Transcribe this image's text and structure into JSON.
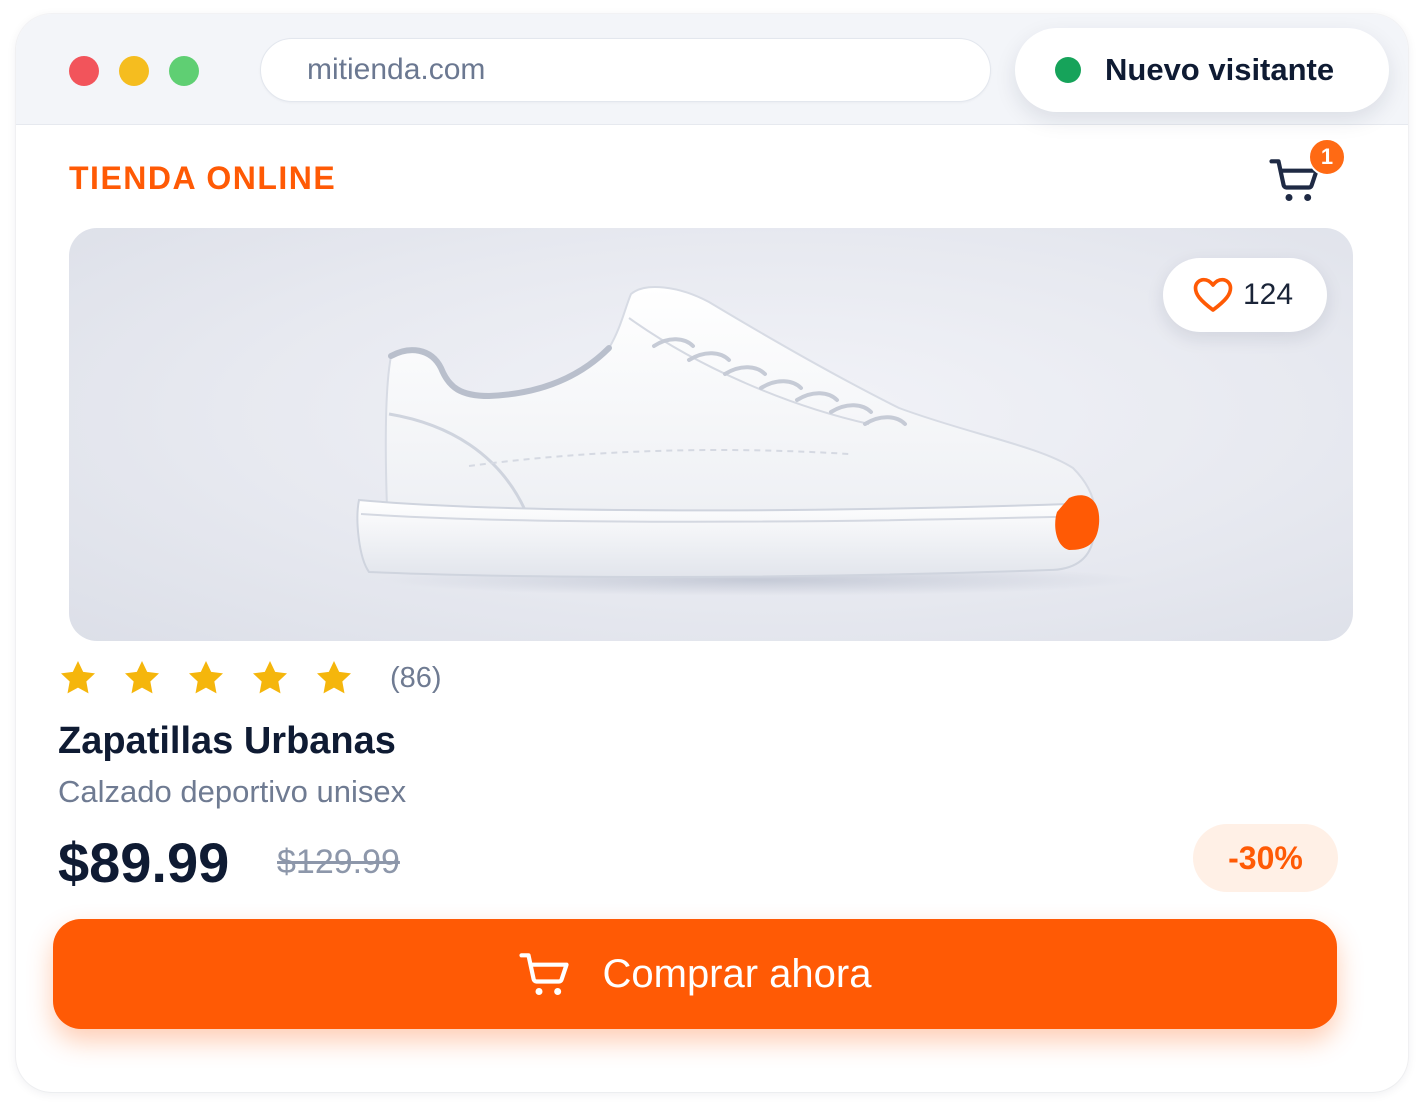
{
  "browser": {
    "url": "mitienda.com",
    "visitor_label": "Nuevo visitante"
  },
  "store": {
    "brand": "TIENDA ONLINE",
    "cart_count": "1"
  },
  "product": {
    "likes": "124",
    "rating_stars": 5,
    "reviews": "(86)",
    "name": "Zapatillas Urbanas",
    "category": "Calzado deportivo unisex",
    "price": "$89.99",
    "old_price": "$129.99",
    "discount": "-30%",
    "buy_label": "Comprar ahora"
  },
  "colors": {
    "accent": "#ff5a05",
    "status_green": "#16a35a",
    "star": "#f5b60c"
  },
  "icons": {
    "window_controls": [
      "close-dot",
      "minimize-dot",
      "maximize-dot"
    ],
    "cart": "cart-icon",
    "heart": "heart-icon",
    "star": "star-icon"
  }
}
